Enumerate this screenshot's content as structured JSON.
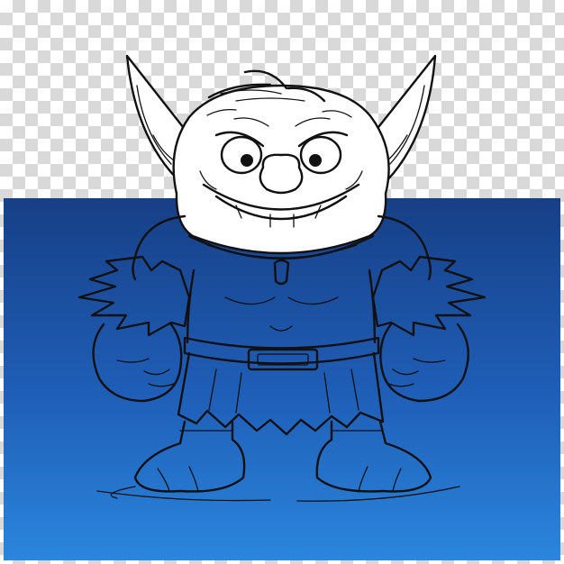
{
  "image": {
    "background": "transparent-checkerboard",
    "checker_color": "#d9d9d9",
    "panel_colors": {
      "top": "#173f86",
      "middle": "#1f5fb8",
      "bottom": "#2b86dc"
    },
    "line_color": "#111111",
    "subject": "goblin-line-art"
  }
}
